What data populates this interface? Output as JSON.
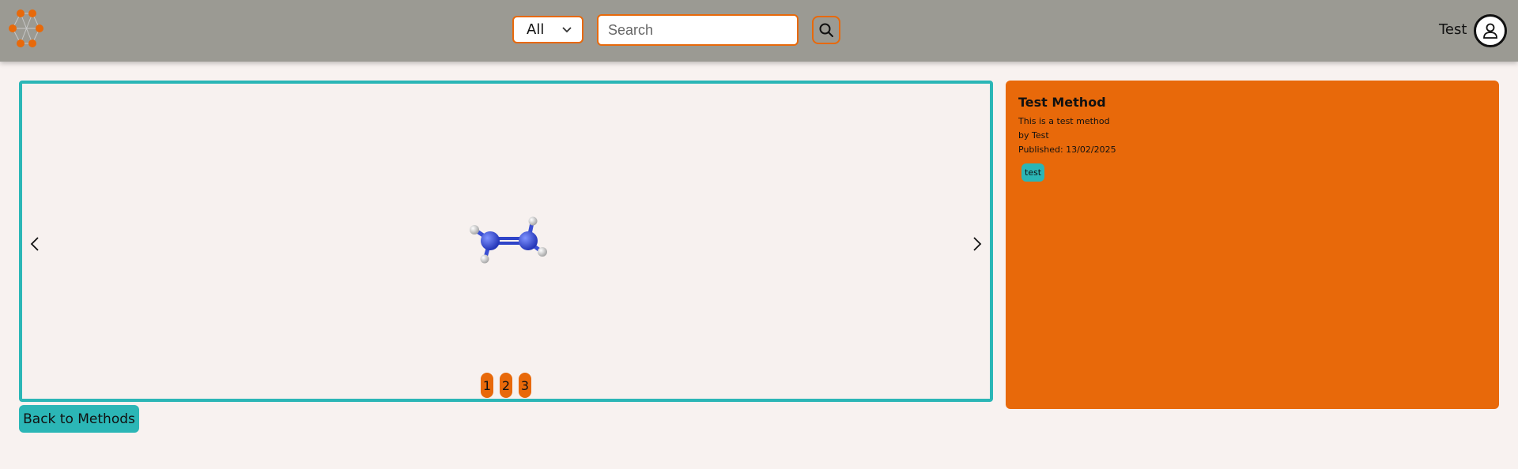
{
  "header": {
    "filter": {
      "selected": "All"
    },
    "search": {
      "placeholder": "Search",
      "value": ""
    },
    "user": {
      "name": "Test"
    }
  },
  "viewer": {
    "pages": [
      "1",
      "2",
      "3"
    ]
  },
  "method": {
    "title": "Test Method",
    "description": "This is a test method",
    "author": "by Test",
    "published": "Published: 13/02/2025",
    "tags": [
      "test"
    ]
  },
  "actions": {
    "back_label": "Back to Methods"
  },
  "colors": {
    "accent": "#e8690a",
    "teal": "#2bb6b6",
    "header_bg": "#9b9a93",
    "atom_nitrogen": "#2f4ad8",
    "atom_hydrogen": "#e8e8e8"
  },
  "icons": {
    "logo": "molecule-hex-logo",
    "filter_chevron": "chevron-down-icon",
    "search": "search-icon",
    "avatar": "user-icon",
    "prev": "chevron-left-icon",
    "next": "chevron-right-icon"
  }
}
